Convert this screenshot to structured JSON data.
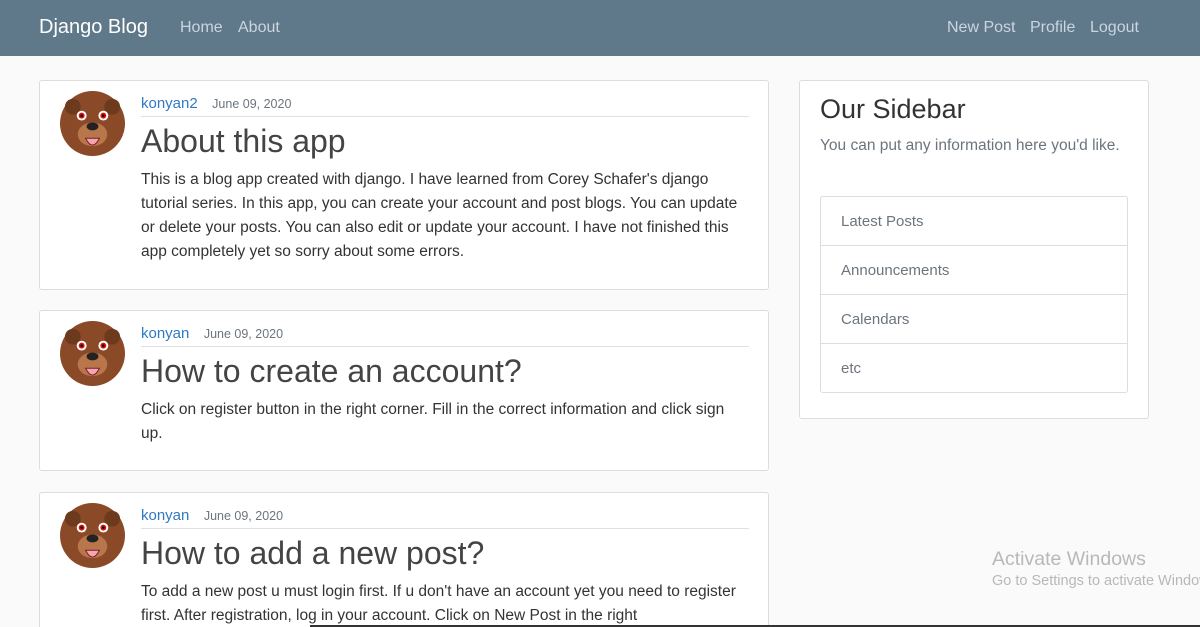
{
  "navbar": {
    "brand": "Django Blog",
    "links_left": [
      "Home",
      "About"
    ],
    "links_right": [
      "New Post",
      "Profile",
      "Logout"
    ]
  },
  "posts": [
    {
      "author": "konyan2",
      "date": "June 09, 2020",
      "title": "About this app",
      "body": "This is a blog app created with django. I have learned from Corey Schafer's django tutorial series. In this app, you can create your account and post blogs. You can update or delete your posts. You can also edit or update your account. I have not finished this app completely yet so sorry about some errors."
    },
    {
      "author": "konyan",
      "date": "June 09, 2020",
      "title": "How to create an account?",
      "body": "Click on register button in the right corner. Fill in the correct information and click sign up."
    },
    {
      "author": "konyan",
      "date": "June 09, 2020",
      "title": "How to add a new post?",
      "body": "To add a new post u must login first. If u don't have an account yet you need to register first. After registration, log in your account. Click on New Post in the right"
    }
  ],
  "sidebar": {
    "title": "Our Sidebar",
    "text": "You can put any information here you'd like.",
    "items": [
      "Latest Posts",
      "Announcements",
      "Calendars",
      "etc"
    ]
  },
  "watermark": {
    "line1": "Activate Windows",
    "line2": "Go to Settings to activate Windows."
  }
}
